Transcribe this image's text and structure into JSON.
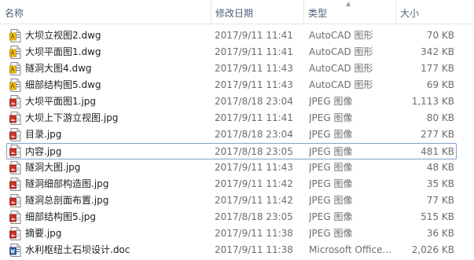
{
  "columns": {
    "name": "名称",
    "date": "修改日期",
    "type": "类型",
    "size": "大小"
  },
  "files": [
    {
      "name": "大坝立视图2.dwg",
      "date": "2017/9/11 11:41",
      "type": "AutoCAD 图形",
      "size": "70 KB",
      "icon": "dwg-file-icon"
    },
    {
      "name": "大坝平面图1.dwg",
      "date": "2017/9/11 11:41",
      "type": "AutoCAD 图形",
      "size": "342 KB",
      "icon": "dwg-file-icon"
    },
    {
      "name": "隧洞大图4.dwg",
      "date": "2017/9/11 11:43",
      "type": "AutoCAD 图形",
      "size": "177 KB",
      "icon": "dwg-file-icon"
    },
    {
      "name": "细部结构图5.dwg",
      "date": "2017/9/11 11:43",
      "type": "AutoCAD 图形",
      "size": "69 KB",
      "icon": "dwg-file-icon"
    },
    {
      "name": "大坝平面图1.jpg",
      "date": "2017/8/18 23:04",
      "type": "JPEG 图像",
      "size": "1,113 KB",
      "icon": "jpg-file-icon"
    },
    {
      "name": "大坝上下游立视图.jpg",
      "date": "2017/9/11 11:41",
      "type": "JPEG 图像",
      "size": "80 KB",
      "icon": "jpg-file-icon"
    },
    {
      "name": "目录.jpg",
      "date": "2017/8/18 23:04",
      "type": "JPEG 图像",
      "size": "277 KB",
      "icon": "jpg-file-icon"
    },
    {
      "name": "内容.jpg",
      "date": "2017/8/18 23:05",
      "type": "JPEG 图像",
      "size": "481 KB",
      "icon": "jpg-file-icon"
    },
    {
      "name": "隧洞大图.jpg",
      "date": "2017/9/11 11:43",
      "type": "JPEG 图像",
      "size": "48 KB",
      "icon": "jpg-file-icon"
    },
    {
      "name": "隧洞细部构造图.jpg",
      "date": "2017/9/11 11:42",
      "type": "JPEG 图像",
      "size": "35 KB",
      "icon": "jpg-file-icon"
    },
    {
      "name": "隧洞总剖面布置.jpg",
      "date": "2017/9/11 11:42",
      "type": "JPEG 图像",
      "size": "77 KB",
      "icon": "jpg-file-icon"
    },
    {
      "name": "细部结构图5.jpg",
      "date": "2017/8/18 23:05",
      "type": "JPEG 图像",
      "size": "515 KB",
      "icon": "jpg-file-icon"
    },
    {
      "name": "摘要.jpg",
      "date": "2017/9/11 11:38",
      "type": "JPEG 图像",
      "size": "36 KB",
      "icon": "jpg-file-icon"
    },
    {
      "name": "水利枢纽土石坝设计.doc",
      "date": "2017/9/11 11:38",
      "type": "Microsoft Office...",
      "size": "2,026 KB",
      "icon": "doc-file-icon"
    }
  ],
  "colors": {
    "header_text": "#4c607a",
    "selection_border": "#7da2ce",
    "secondary_text": "#6d6d6d"
  }
}
